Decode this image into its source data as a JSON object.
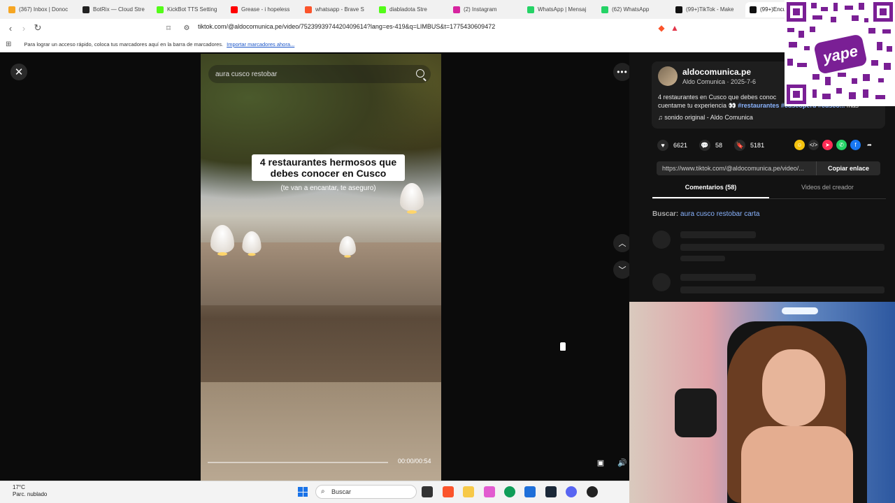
{
  "browser": {
    "tabs": [
      {
        "label": "(367) Inbox | Donoc",
        "color": "#f6a623"
      },
      {
        "label": "BotRix — Cloud Stre",
        "color": "#222222"
      },
      {
        "label": "KickBot TTS Setting",
        "color": "#53fc18"
      },
      {
        "label": "Grease - i hopeless",
        "color": "#ff0000"
      },
      {
        "label": "whatsapp - Brave S",
        "color": "#fb542b"
      },
      {
        "label": "diabladota Stre",
        "color": "#53fc18"
      },
      {
        "label": "(2) Instagram",
        "color": "#d6249f"
      },
      {
        "label": "WhatsApp | Mensaj",
        "color": "#25d366"
      },
      {
        "label": "(62) WhatsApp",
        "color": "#25d366"
      },
      {
        "label": "(99+)TikTok - Make",
        "color": "#111111"
      },
      {
        "label": "(99+)Encuen",
        "color": "#111111"
      }
    ],
    "url": "tiktok.com/@aldocomunica.pe/video/7523993974420409614?lang=es-419&q=LIMBUS&t=1775430609472",
    "bookmarks_hint": "Para lograr un acceso rápido, coloca tus marcadores aquí en la barra de marcadores.",
    "bookmarks_link": "Importar marcadores ahora..."
  },
  "video": {
    "search_text": "aura cusco restobar",
    "caption_title": "4 restaurantes hermosos que debes conocer en Cusco",
    "caption_sub": "(te van a encantar, te aseguro)",
    "time": "00:00/00:54",
    "progress": 0.0
  },
  "panel": {
    "username": "aldocomunica.pe",
    "subline": "Aldo Comunica · 2025-7-6",
    "description": "4 restaurantes en Cusco que debes conoc",
    "description2": "cuentame tu experiencia 👀",
    "hashtags": "#restaurantes #cuscoperu #cusco...",
    "more": "más",
    "sound": "sonido original - Aldo Comunica",
    "likes": "6621",
    "comments": "58",
    "saves": "5181",
    "link": "https://www.tiktok.com/@aldocomunica.pe/video/...",
    "copy_label": "Copiar enlace",
    "tab_comments": "Comentarios (58)",
    "tab_videos": "Videos del creador",
    "buscar_label": "Buscar:",
    "buscar_query": "aura cusco restobar carta"
  },
  "overlay": {
    "qr_brand": "yape"
  },
  "taskbar": {
    "temp": "17°C",
    "weather": "Parc. nublado",
    "search": "Buscar"
  }
}
